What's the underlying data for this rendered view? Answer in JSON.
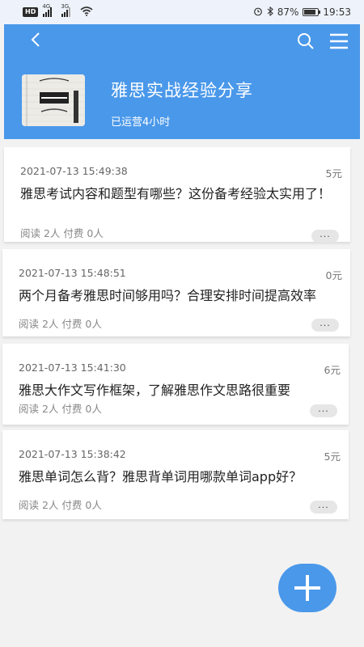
{
  "status_bar": {
    "hd": "HD",
    "sim1": "4G",
    "sim2": "3G",
    "battery_percent": "87%",
    "battery_level": 0.87,
    "time": "19:53",
    "icons": [
      "alarm-icon",
      "bluetooth-icon",
      "wifi-icon",
      "battery-icon"
    ]
  },
  "header": {
    "channel_name": "雅思实战经验分享",
    "subtitle": "已运营4小时",
    "bg_color": "#4a98ea",
    "icons": [
      "back-icon",
      "search-icon",
      "menu-icon"
    ]
  },
  "posts": [
    {
      "time": "2021-07-13 15:49:38",
      "price": "5元",
      "title": "雅思考试内容和题型有哪些？这份备考经验太实用了！",
      "meta": "阅读 2人 付费 0人",
      "more": "···"
    },
    {
      "time": "2021-07-13 15:48:51",
      "price": "0元",
      "title": "两个月备考雅思时间够用吗？合理安排时间提高效率",
      "meta": "阅读 2人 付费 0人",
      "more": "···"
    },
    {
      "time": "2021-07-13 15:41:30",
      "price": "6元",
      "title": "雅思大作文写作框架，了解雅思作文思路很重要",
      "meta": "阅读 2人 付费 0人",
      "more": "···"
    },
    {
      "time": "2021-07-13 15:38:42",
      "price": "5元",
      "title": "雅思单词怎么背？雅思背单词用哪款单词app好？",
      "meta": "阅读 2人 付费 0人",
      "more": "···"
    }
  ],
  "fab": {
    "icon": "plus-icon",
    "color": "#4a98ea"
  }
}
